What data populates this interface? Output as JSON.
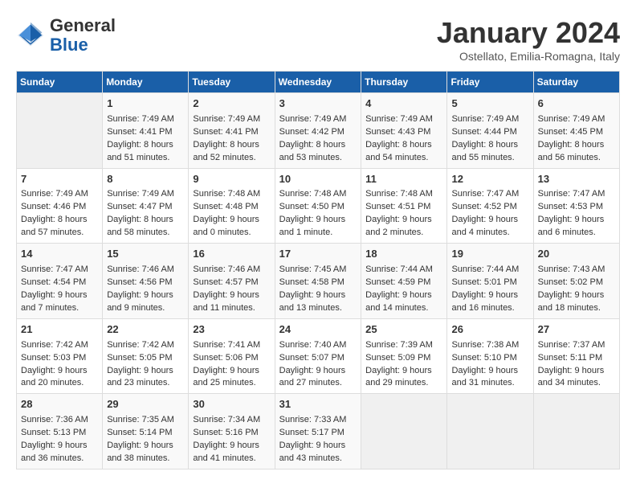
{
  "header": {
    "logo_general": "General",
    "logo_blue": "Blue",
    "month": "January 2024",
    "location": "Ostellato, Emilia-Romagna, Italy"
  },
  "days_of_week": [
    "Sunday",
    "Monday",
    "Tuesday",
    "Wednesday",
    "Thursday",
    "Friday",
    "Saturday"
  ],
  "weeks": [
    [
      {
        "day": "",
        "empty": true
      },
      {
        "day": "1",
        "sunrise": "Sunrise: 7:49 AM",
        "sunset": "Sunset: 4:41 PM",
        "daylight": "Daylight: 8 hours and 51 minutes."
      },
      {
        "day": "2",
        "sunrise": "Sunrise: 7:49 AM",
        "sunset": "Sunset: 4:41 PM",
        "daylight": "Daylight: 8 hours and 52 minutes."
      },
      {
        "day": "3",
        "sunrise": "Sunrise: 7:49 AM",
        "sunset": "Sunset: 4:42 PM",
        "daylight": "Daylight: 8 hours and 53 minutes."
      },
      {
        "day": "4",
        "sunrise": "Sunrise: 7:49 AM",
        "sunset": "Sunset: 4:43 PM",
        "daylight": "Daylight: 8 hours and 54 minutes."
      },
      {
        "day": "5",
        "sunrise": "Sunrise: 7:49 AM",
        "sunset": "Sunset: 4:44 PM",
        "daylight": "Daylight: 8 hours and 55 minutes."
      },
      {
        "day": "6",
        "sunrise": "Sunrise: 7:49 AM",
        "sunset": "Sunset: 4:45 PM",
        "daylight": "Daylight: 8 hours and 56 minutes."
      }
    ],
    [
      {
        "day": "7",
        "sunrise": "Sunrise: 7:49 AM",
        "sunset": "Sunset: 4:46 PM",
        "daylight": "Daylight: 8 hours and 57 minutes."
      },
      {
        "day": "8",
        "sunrise": "Sunrise: 7:49 AM",
        "sunset": "Sunset: 4:47 PM",
        "daylight": "Daylight: 8 hours and 58 minutes."
      },
      {
        "day": "9",
        "sunrise": "Sunrise: 7:48 AM",
        "sunset": "Sunset: 4:48 PM",
        "daylight": "Daylight: 9 hours and 0 minutes."
      },
      {
        "day": "10",
        "sunrise": "Sunrise: 7:48 AM",
        "sunset": "Sunset: 4:50 PM",
        "daylight": "Daylight: 9 hours and 1 minute."
      },
      {
        "day": "11",
        "sunrise": "Sunrise: 7:48 AM",
        "sunset": "Sunset: 4:51 PM",
        "daylight": "Daylight: 9 hours and 2 minutes."
      },
      {
        "day": "12",
        "sunrise": "Sunrise: 7:47 AM",
        "sunset": "Sunset: 4:52 PM",
        "daylight": "Daylight: 9 hours and 4 minutes."
      },
      {
        "day": "13",
        "sunrise": "Sunrise: 7:47 AM",
        "sunset": "Sunset: 4:53 PM",
        "daylight": "Daylight: 9 hours and 6 minutes."
      }
    ],
    [
      {
        "day": "14",
        "sunrise": "Sunrise: 7:47 AM",
        "sunset": "Sunset: 4:54 PM",
        "daylight": "Daylight: 9 hours and 7 minutes."
      },
      {
        "day": "15",
        "sunrise": "Sunrise: 7:46 AM",
        "sunset": "Sunset: 4:56 PM",
        "daylight": "Daylight: 9 hours and 9 minutes."
      },
      {
        "day": "16",
        "sunrise": "Sunrise: 7:46 AM",
        "sunset": "Sunset: 4:57 PM",
        "daylight": "Daylight: 9 hours and 11 minutes."
      },
      {
        "day": "17",
        "sunrise": "Sunrise: 7:45 AM",
        "sunset": "Sunset: 4:58 PM",
        "daylight": "Daylight: 9 hours and 13 minutes."
      },
      {
        "day": "18",
        "sunrise": "Sunrise: 7:44 AM",
        "sunset": "Sunset: 4:59 PM",
        "daylight": "Daylight: 9 hours and 14 minutes."
      },
      {
        "day": "19",
        "sunrise": "Sunrise: 7:44 AM",
        "sunset": "Sunset: 5:01 PM",
        "daylight": "Daylight: 9 hours and 16 minutes."
      },
      {
        "day": "20",
        "sunrise": "Sunrise: 7:43 AM",
        "sunset": "Sunset: 5:02 PM",
        "daylight": "Daylight: 9 hours and 18 minutes."
      }
    ],
    [
      {
        "day": "21",
        "sunrise": "Sunrise: 7:42 AM",
        "sunset": "Sunset: 5:03 PM",
        "daylight": "Daylight: 9 hours and 20 minutes."
      },
      {
        "day": "22",
        "sunrise": "Sunrise: 7:42 AM",
        "sunset": "Sunset: 5:05 PM",
        "daylight": "Daylight: 9 hours and 23 minutes."
      },
      {
        "day": "23",
        "sunrise": "Sunrise: 7:41 AM",
        "sunset": "Sunset: 5:06 PM",
        "daylight": "Daylight: 9 hours and 25 minutes."
      },
      {
        "day": "24",
        "sunrise": "Sunrise: 7:40 AM",
        "sunset": "Sunset: 5:07 PM",
        "daylight": "Daylight: 9 hours and 27 minutes."
      },
      {
        "day": "25",
        "sunrise": "Sunrise: 7:39 AM",
        "sunset": "Sunset: 5:09 PM",
        "daylight": "Daylight: 9 hours and 29 minutes."
      },
      {
        "day": "26",
        "sunrise": "Sunrise: 7:38 AM",
        "sunset": "Sunset: 5:10 PM",
        "daylight": "Daylight: 9 hours and 31 minutes."
      },
      {
        "day": "27",
        "sunrise": "Sunrise: 7:37 AM",
        "sunset": "Sunset: 5:11 PM",
        "daylight": "Daylight: 9 hours and 34 minutes."
      }
    ],
    [
      {
        "day": "28",
        "sunrise": "Sunrise: 7:36 AM",
        "sunset": "Sunset: 5:13 PM",
        "daylight": "Daylight: 9 hours and 36 minutes."
      },
      {
        "day": "29",
        "sunrise": "Sunrise: 7:35 AM",
        "sunset": "Sunset: 5:14 PM",
        "daylight": "Daylight: 9 hours and 38 minutes."
      },
      {
        "day": "30",
        "sunrise": "Sunrise: 7:34 AM",
        "sunset": "Sunset: 5:16 PM",
        "daylight": "Daylight: 9 hours and 41 minutes."
      },
      {
        "day": "31",
        "sunrise": "Sunrise: 7:33 AM",
        "sunset": "Sunset: 5:17 PM",
        "daylight": "Daylight: 9 hours and 43 minutes."
      },
      {
        "day": "",
        "empty": true
      },
      {
        "day": "",
        "empty": true
      },
      {
        "day": "",
        "empty": true
      }
    ]
  ]
}
